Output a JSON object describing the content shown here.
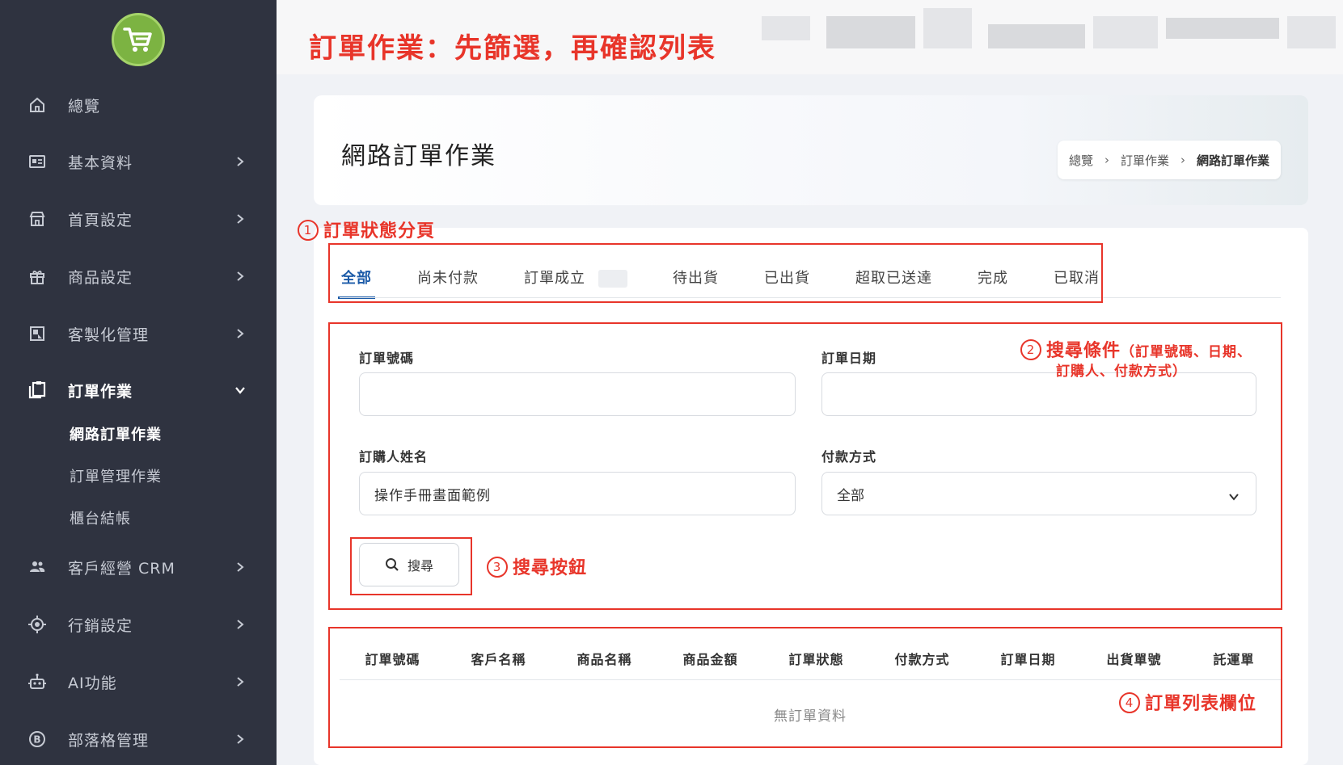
{
  "annotation_title": "訂單作業：先篩選，再確認列表",
  "sidebar": {
    "items": [
      {
        "label": "總覽",
        "icon": "home-icon"
      },
      {
        "label": "基本資料",
        "icon": "id-card-icon"
      },
      {
        "label": "首頁設定",
        "icon": "store-icon"
      },
      {
        "label": "商品設定",
        "icon": "gift-icon"
      },
      {
        "label": "客製化管理",
        "icon": "customize-icon"
      },
      {
        "label": "訂單作業",
        "icon": "clipboard-icon"
      },
      {
        "label": "客戶經營 CRM",
        "icon": "users-icon"
      },
      {
        "label": "行銷設定",
        "icon": "target-icon"
      },
      {
        "label": "AI功能",
        "icon": "robot-icon"
      },
      {
        "label": "部落格管理",
        "icon": "blog-icon"
      }
    ],
    "sub_items": [
      "網路訂單作業",
      "訂單管理作業",
      "櫃台結帳"
    ]
  },
  "page": {
    "title": "網路訂單作業",
    "breadcrumb": [
      "總覽",
      "訂單作業",
      "網路訂單作業"
    ]
  },
  "tabs": [
    "全部",
    "尚未付款",
    "訂單成立",
    "待出貨",
    "已出貨",
    "超取已送達",
    "完成",
    "已取消"
  ],
  "search_form": {
    "order_no_label": "訂單號碼",
    "order_date_label": "訂單日期",
    "buyer_name_label": "訂購人姓名",
    "buyer_name_value": "操作手冊畫面範例",
    "payment_label": "付款方式",
    "payment_value": "全部",
    "search_button": "搜尋"
  },
  "table": {
    "columns": [
      "訂單號碼",
      "客戶名稱",
      "商品名稱",
      "商品金額",
      "訂單狀態",
      "付款方式",
      "訂單日期",
      "出貨單號",
      "託運單"
    ],
    "empty_text": "無訂單資料"
  },
  "annotations": {
    "a1_num": "1",
    "a1": "訂單狀態分頁",
    "a2_num": "2",
    "a2": "搜尋條件",
    "a2_detail_line1": "（訂單號碼、日期、",
    "a2_detail_line2": "訂購人、付款方式）",
    "a3_num": "3",
    "a3": "搜尋按鈕",
    "a4_num": "4",
    "a4": "訂單列表欄位"
  },
  "colors": {
    "sidebar_bg": "#2f3340",
    "accent_blue": "#1c5ba8",
    "annotation_red": "#e8352a",
    "logo_green": "#7cb342"
  }
}
